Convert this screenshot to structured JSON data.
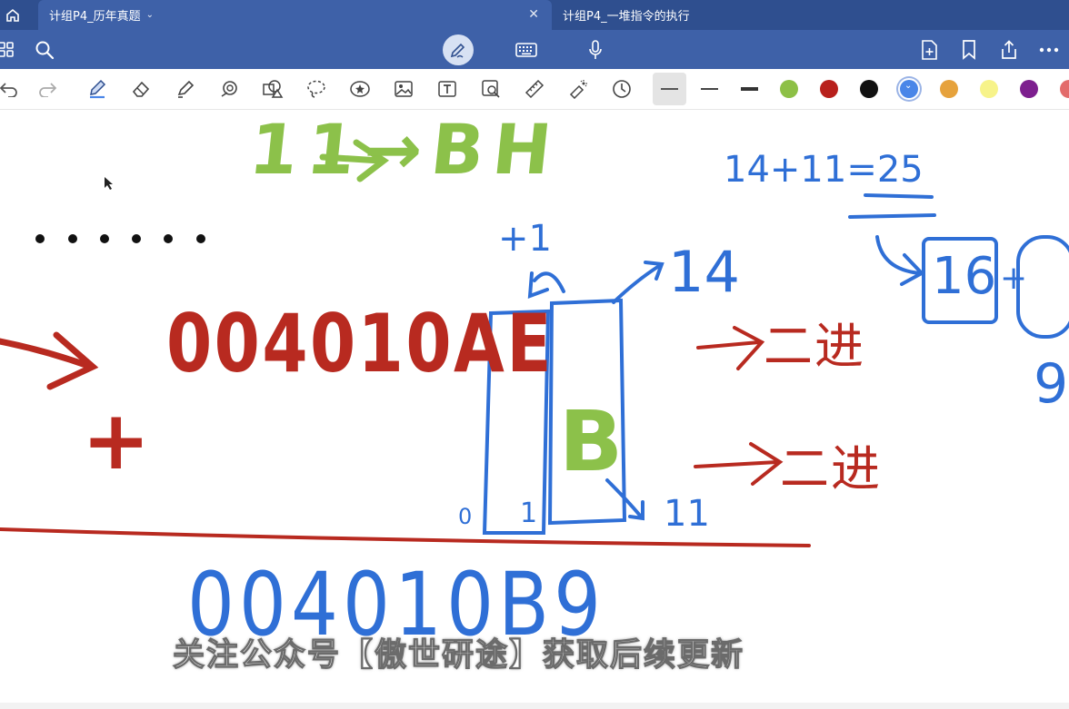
{
  "tabs": [
    {
      "label": "计组P4_历年真题",
      "active": true
    },
    {
      "label": "计组P4_一堆指令的执行",
      "active": false
    }
  ],
  "topbar": {
    "left_icons": [
      "grid-icon",
      "search-icon"
    ],
    "center_icons": [
      "pen-mode-icon",
      "keyboard-icon",
      "microphone-icon"
    ],
    "right_icons": [
      "add-page-icon",
      "bookmark-icon",
      "share-icon",
      "more-icon"
    ]
  },
  "toolbar": {
    "tools": [
      "undo-icon",
      "redo-icon",
      "pen-icon",
      "eraser-icon",
      "highlighter-icon",
      "shape-icon",
      "sticker-shapes-icon",
      "lasso-icon",
      "star-sticker-icon",
      "image-icon",
      "text-icon",
      "scan-icon",
      "ruler-icon",
      "laser-icon",
      "clock-icon"
    ],
    "stroke_widths": [
      "thin",
      "medium",
      "thick"
    ],
    "colors": [
      "#8dc046",
      "#b8201c",
      "#111111",
      "#4a86e8",
      "#e6a23c",
      "#f7f38a",
      "#7d1f8f",
      "#e36b6b"
    ],
    "selected_color": "#4a86e8"
  },
  "canvas": {
    "top_green_note": "11→BH",
    "dots": "· · · · · ·",
    "red_number": "004010AE",
    "plus_sign": "+",
    "green_B": "B",
    "blue_result": "004010B9",
    "carry_note": "+1",
    "note_14": "14",
    "note_11": "11",
    "carry_zero": "0",
    "carry_one": "1",
    "sum_note": "14+11=25",
    "box_16": "16",
    "note_9": "9",
    "note_plus": "+",
    "binary_note_1": "→二进",
    "binary_note_2": "→二进",
    "ink_colors": {
      "red": "#b82a20",
      "green": "#8cc14a",
      "blue": "#2f6fd6"
    }
  },
  "caption": "关注公众号【傲世研途】获取后续更新"
}
